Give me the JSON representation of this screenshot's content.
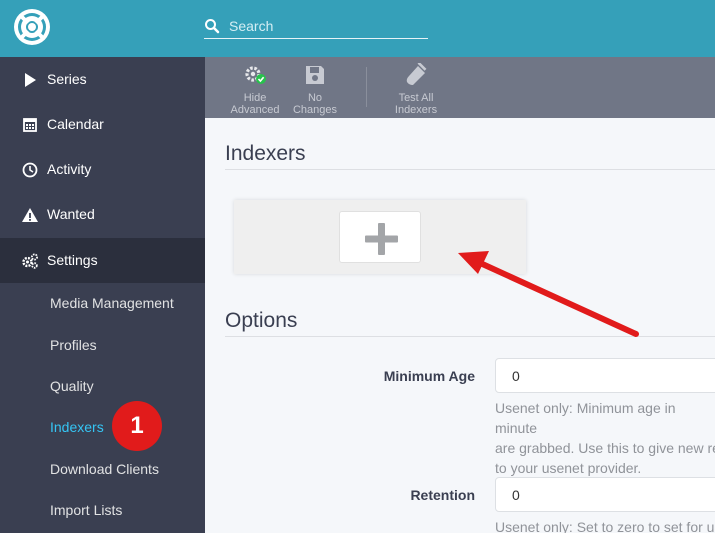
{
  "header": {
    "logo_icon": "sonarr-logo",
    "search": {
      "placeholder": "Search",
      "value": ""
    }
  },
  "sidebar": {
    "items": [
      {
        "label": "Series",
        "icon": "play-icon"
      },
      {
        "label": "Calendar",
        "icon": "calendar-icon"
      },
      {
        "label": "Activity",
        "icon": "clock-icon"
      },
      {
        "label": "Wanted",
        "icon": "warning-icon"
      },
      {
        "label": "Settings",
        "icon": "gears-icon"
      }
    ],
    "settings_subitems": [
      {
        "label": "Media Management"
      },
      {
        "label": "Profiles"
      },
      {
        "label": "Quality"
      },
      {
        "label": "Indexers"
      },
      {
        "label": "Download Clients"
      },
      {
        "label": "Import Lists"
      }
    ],
    "active_subitem": "Indexers",
    "annotation_badge": "1"
  },
  "toolbar": {
    "buttons": [
      {
        "line1": "Hide",
        "line2": "Advanced",
        "icon": "gear-check-icon"
      },
      {
        "line1": "No",
        "line2": "Changes",
        "icon": "save-icon"
      },
      {
        "line1": "Test All",
        "line2": "Indexers",
        "icon": "test-tube-icon"
      }
    ]
  },
  "content": {
    "indexers_title": "Indexers",
    "add_button_icon": "plus-icon",
    "options_title": "Options",
    "fields": [
      {
        "label": "Minimum Age",
        "value": "0",
        "help": [
          "Usenet only: Minimum age in minute",
          "are grabbed. Use this to give new re",
          "to your usenet provider."
        ]
      },
      {
        "label": "Retention",
        "value": "0",
        "help": [
          "Usenet only: Set to zero to set for ur"
        ]
      }
    ]
  },
  "colors": {
    "header": "#35a0b9",
    "sidebar": "#3a3f51",
    "toolbar": "#707686",
    "active_link": "#35c5f4",
    "annotation": "#e11b1b"
  }
}
